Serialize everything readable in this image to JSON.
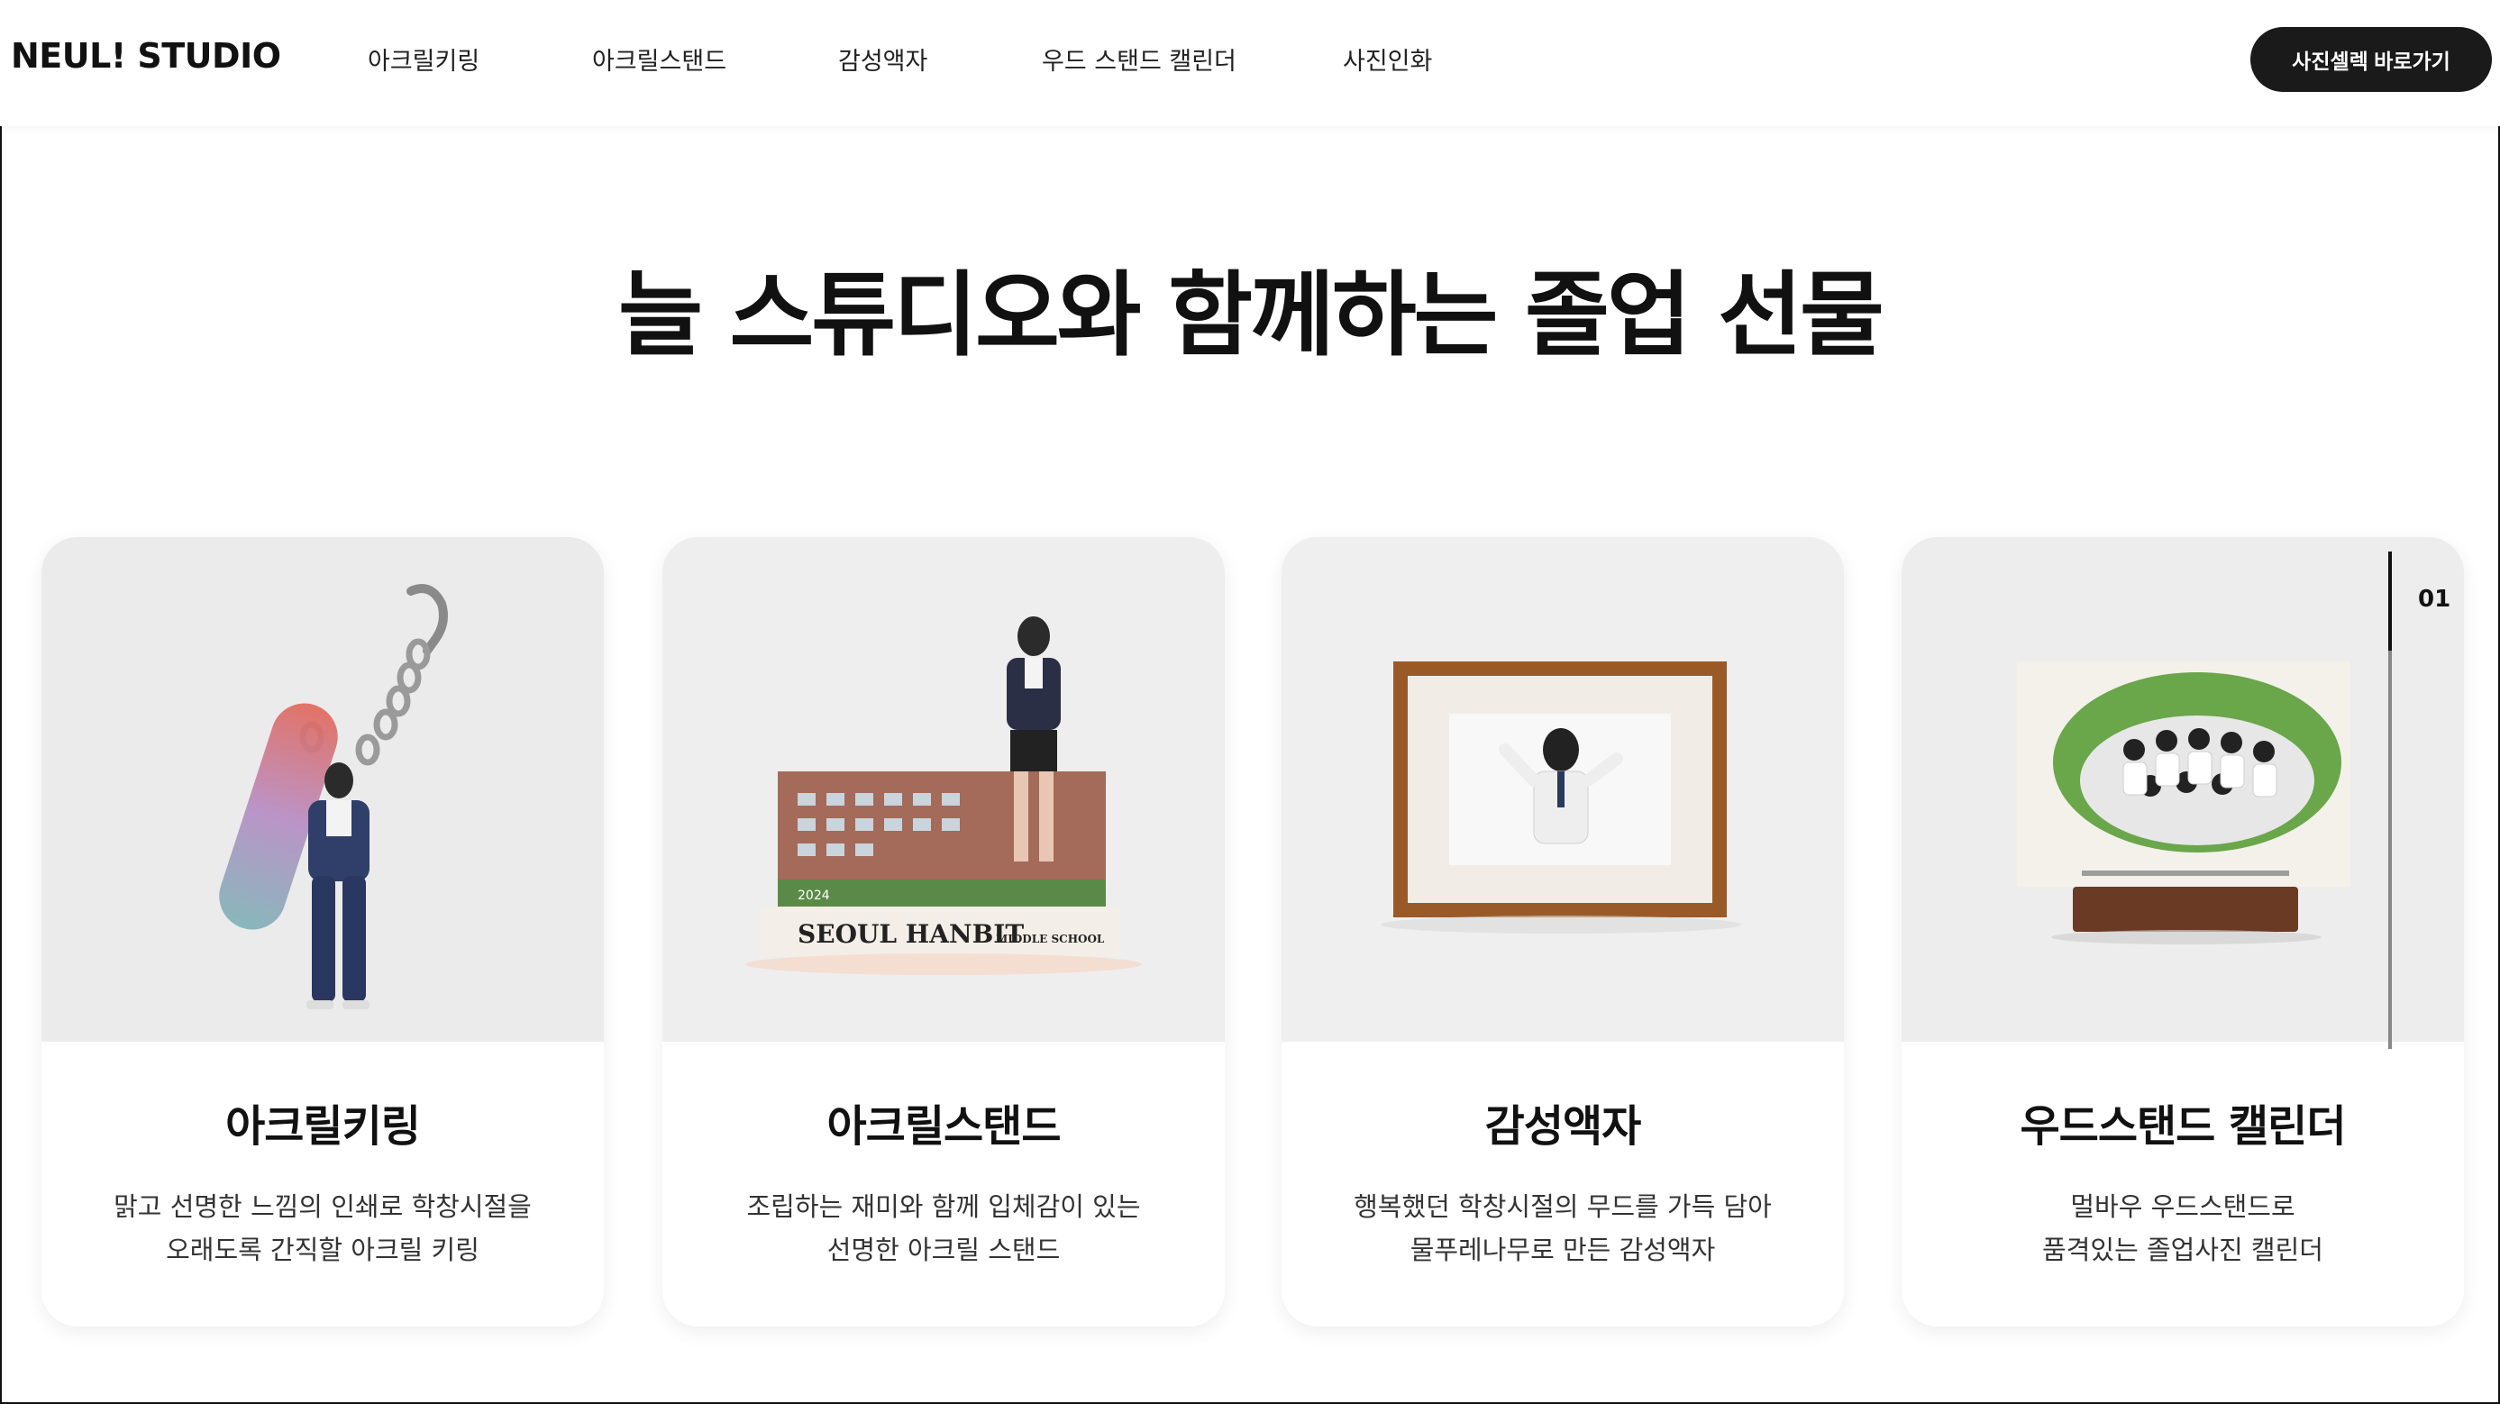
{
  "header": {
    "logo": "NEUL! STUDIO",
    "menu": [
      "아크릴키링",
      "아크릴스탠드",
      "감성액자",
      "우드 스탠드 캘린더",
      "사진인화"
    ],
    "cta_label": "사진셀렉 바로가기"
  },
  "hero": {
    "title": "늘 스튜디오와 함께하는 졸업 선물"
  },
  "cards": [
    {
      "title": "아크릴키링",
      "desc_line1": "맑고 선명한 느낌의 인쇄로 학창시절을",
      "desc_line2": "오래도록 간직할 아크릴 키링",
      "image": "acrylic-keyring-photo"
    },
    {
      "title": "아크릴스탠드",
      "desc_line1": "조립하는 재미와 함께 입체감이 있는",
      "desc_line2": "선명한 아크릴 스탠드",
      "image": "acrylic-stand-photo",
      "image_text_main": "SEOUL HANBIT",
      "image_text_sub": "MIDDLE SCHOOL",
      "image_text_year": "2024"
    },
    {
      "title": "감성액자",
      "desc_line1": "행복했던 학창시절의 무드를 가득 담아",
      "desc_line2": "물푸레나무로 만든 감성액자",
      "image": "wood-frame-photo"
    },
    {
      "title": "우드스탠드 캘린더",
      "desc_line1": "멀바우 우드스탠드로",
      "desc_line2": "품격있는 졸업사진 캘린더",
      "image": "wood-stand-calendar-photo"
    }
  ],
  "slider": {
    "current": "01"
  },
  "colors": {
    "cta_bg": "#1a1a1a",
    "card_image_bg": "#ededed",
    "text_primary": "#111111"
  }
}
